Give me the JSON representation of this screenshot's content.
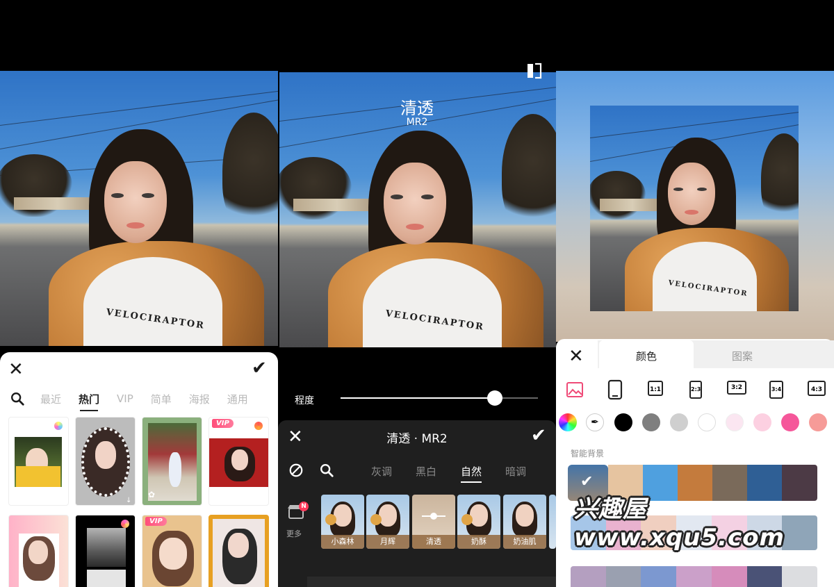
{
  "panel1": {
    "sheet": {
      "close_icon": "close-icon",
      "confirm_icon": "check-icon",
      "tabs": [
        "最近",
        "热门",
        "VIP",
        "简单",
        "海报",
        "通用"
      ],
      "active_tab": "热门",
      "templates": [
        {
          "badge": "",
          "dot": "gradient"
        },
        {
          "badge": "",
          "dot": ""
        },
        {
          "badge": "",
          "dot": ""
        },
        {
          "badge": "VIP",
          "dot": "gradient"
        },
        {
          "badge": "",
          "dot": ""
        },
        {
          "badge": "",
          "dot": "gradient"
        },
        {
          "badge": "VIP",
          "dot": ""
        },
        {
          "badge": "",
          "dot": ""
        }
      ]
    }
  },
  "panel2": {
    "filter_name": "清透",
    "filter_code": "MR2",
    "degree_label": "程度",
    "degree_value": 0.78,
    "sheet_title": "清透 · MR2",
    "categories": [
      "灰调",
      "黑白",
      "自然",
      "暗调"
    ],
    "active_category": "自然",
    "filters": [
      {
        "label": "小森林"
      },
      {
        "label": "月辉"
      },
      {
        "label": "清透",
        "selected": true
      },
      {
        "label": "奶酥"
      },
      {
        "label": "奶油肌"
      }
    ],
    "more_label": "更多",
    "more_badge": "N"
  },
  "panel3": {
    "tabs": [
      "颜色",
      "图案"
    ],
    "active_tab": "颜色",
    "ratios": [
      "1:1",
      "2:3",
      "3:2",
      "3:4",
      "4:3"
    ],
    "color_dots": [
      "#000000",
      "#7f7f7f",
      "#cfcfcf",
      "#ffffff",
      "#fbe6f1",
      "#fcd0e1",
      "#f5579a",
      "#f69b98"
    ],
    "smart_bg_label": "智能背景",
    "smart_swatches": [
      "#e6c4a0",
      "#4fa0df",
      "#c47b3d",
      "#7a6a5a",
      "#2f5f95",
      "#4c3a45"
    ],
    "strip1": [
      "#a6c6e8",
      "#e9b2cf",
      "#f0cfc0",
      "#e2e8f1",
      "#f4d1e3",
      "#cdd8e6",
      "#8fa5b8"
    ],
    "strip2": [
      "#b49fc0",
      "#9aa0b0",
      "#7c98d0",
      "#cba0c9",
      "#d68cbb",
      "#4a5276",
      "#dcdde0"
    ]
  },
  "watermark": "兴趣屋 www.xqu5.com"
}
